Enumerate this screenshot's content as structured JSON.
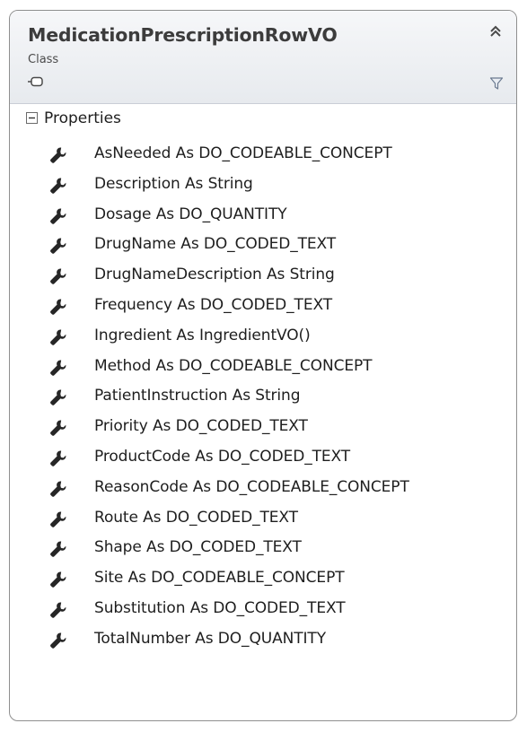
{
  "class": {
    "name": "MedicationPrescriptionRowVO",
    "stereotype": "Class"
  },
  "icons": {
    "collapse": "double-chevron-up-icon",
    "class_shape": "class-shape-icon",
    "filter": "filter-icon",
    "section_toggle": "minus-box-icon",
    "property": "wrench-icon"
  },
  "colors": {
    "header_gradient_top": "#f6f7f9",
    "header_gradient_bottom": "#e7eaee",
    "border": "#8f8f8f",
    "text": "#1e1e1e",
    "filter_icon": "#6b7a90"
  },
  "section": {
    "label": "Properties"
  },
  "properties": [
    "AsNeeded As DO_CODEABLE_CONCEPT",
    "Description As String",
    "Dosage As DO_QUANTITY",
    "DrugName As DO_CODED_TEXT",
    "DrugNameDescription As String",
    "Frequency As DO_CODED_TEXT",
    "Ingredient As IngredientVO()",
    "Method As DO_CODEABLE_CONCEPT",
    "PatientInstruction As String",
    "Priority As DO_CODED_TEXT",
    "ProductCode As DO_CODED_TEXT",
    "ReasonCode As DO_CODEABLE_CONCEPT",
    "Route As DO_CODED_TEXT",
    "Shape As DO_CODED_TEXT",
    "Site As DO_CODEABLE_CONCEPT",
    "Substitution As DO_CODED_TEXT",
    "TotalNumber As DO_QUANTITY"
  ]
}
